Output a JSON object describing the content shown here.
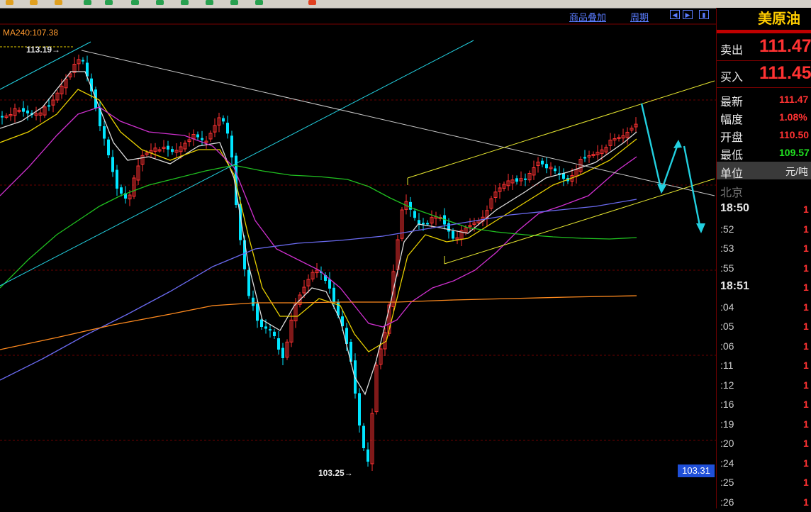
{
  "toolbar": {
    "icons": [
      {
        "name": "toolbar-icon-1",
        "color": "#e0a020"
      },
      {
        "name": "toolbar-icon-2",
        "color": "#e0a020"
      },
      {
        "name": "toolbar-icon-3",
        "color": "#e0a020"
      },
      {
        "name": "toolbar-icon-4",
        "color": "#28a050"
      },
      {
        "name": "toolbar-icon-5",
        "color": "#28a050"
      },
      {
        "name": "toolbar-icon-6",
        "color": "#28a050"
      },
      {
        "name": "toolbar-icon-7",
        "color": "#28a050"
      },
      {
        "name": "toolbar-icon-8",
        "color": "#28a050"
      },
      {
        "name": "toolbar-icon-9",
        "color": "#28a050"
      },
      {
        "name": "toolbar-icon-10",
        "color": "#28a050"
      },
      {
        "name": "toolbar-icon-11",
        "color": "#28a050"
      },
      {
        "name": "toolbar-icon-12",
        "color": "#e04020"
      }
    ]
  },
  "chart_header": {
    "overlay_label": "商品叠加",
    "period_label": "周期"
  },
  "chart_data": {
    "type": "candlestick",
    "ma_label": "MA240:107.38",
    "high_annotation": "113.19",
    "low_annotation": "103.25",
    "current_price_tag": "103.31",
    "colors": {
      "up": "#ff3232",
      "down": "#00e5ff",
      "ma_white": "#dddddd",
      "ma_yellow": "#e8d000",
      "ma_magenta": "#d030d0",
      "ma_green": "#20c020",
      "ma_blue": "#6a6af0",
      "ma_orange": "#ff8a1e",
      "trend": "#e8e830",
      "trend2": "#22d0e0",
      "downtrend": "#c8c8c8"
    }
  },
  "quote_panel": {
    "title": "美原油",
    "sell": {
      "label": "卖出",
      "value": "111.47"
    },
    "buy": {
      "label": "买入",
      "value": "111.45"
    },
    "rows": [
      {
        "label": "最新",
        "value": "111.47",
        "color": "#ff3232"
      },
      {
        "label": "幅度",
        "value": "1.08%",
        "color": "#ff3232"
      },
      {
        "label": "开盘",
        "value": "110.50",
        "color": "#ff3232"
      },
      {
        "label": "最低",
        "value": "109.57",
        "color": "#20e020"
      }
    ],
    "unit": {
      "label": "单位",
      "value": "元/吨"
    },
    "location": "北京",
    "ticks": [
      {
        "time": "18:50",
        "major": true,
        "value": "1"
      },
      {
        "time": ":52",
        "major": false,
        "value": "1"
      },
      {
        "time": ":53",
        "major": false,
        "value": "1"
      },
      {
        "time": ":55",
        "major": false,
        "value": "1"
      },
      {
        "time": "18:51",
        "major": true,
        "value": "1"
      },
      {
        "time": ":04",
        "major": false,
        "value": "1"
      },
      {
        "time": ":05",
        "major": false,
        "value": "1"
      },
      {
        "time": ":06",
        "major": false,
        "value": "1"
      },
      {
        "time": ":11",
        "major": false,
        "value": "1"
      },
      {
        "time": ":12",
        "major": false,
        "value": "1"
      },
      {
        "time": ":16",
        "major": false,
        "value": "1"
      },
      {
        "time": ":19",
        "major": false,
        "value": "1"
      },
      {
        "time": ":20",
        "major": false,
        "value": "1"
      },
      {
        "time": ":24",
        "major": false,
        "value": "1"
      },
      {
        "time": ":25",
        "major": false,
        "value": "1"
      },
      {
        "time": ":26",
        "major": false,
        "value": "1"
      }
    ]
  }
}
